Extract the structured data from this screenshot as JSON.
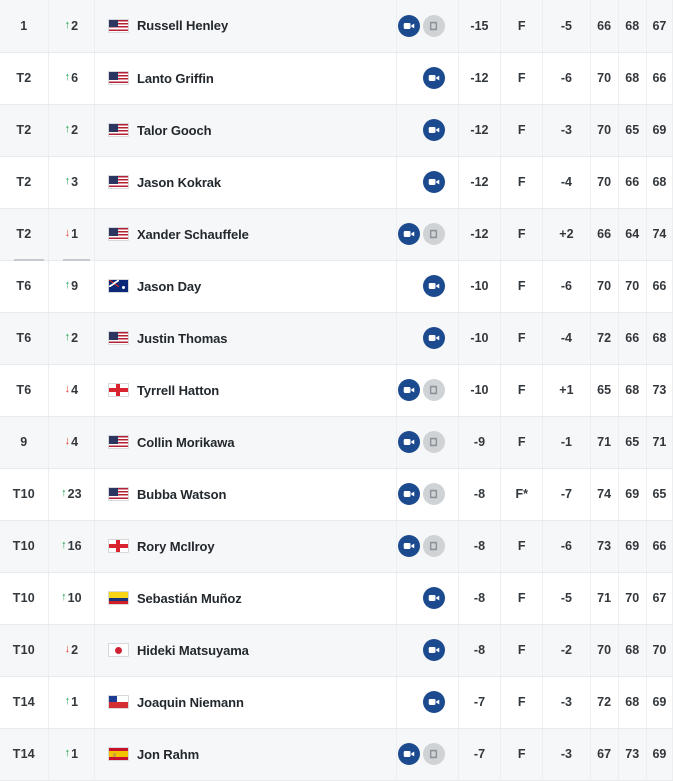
{
  "colors": {
    "accent_blue": "#1c4a8f",
    "doc_gray": "#cfd3d6",
    "up_green": "#19a04b",
    "down_red": "#e03127",
    "row_shade": "#f6f7f8",
    "row_plain": "#ffffff",
    "border": "#e8eaec",
    "text": "#2b2f33"
  },
  "icons": {
    "video": "video-camera-icon",
    "doc": "scorecard-icon",
    "arrow_up": "arrow-up-icon",
    "arrow_down": "arrow-down-icon"
  },
  "leaderboard": {
    "rows": [
      {
        "position": "1",
        "move_dir": "up",
        "move_value": "2",
        "country": "us",
        "country_name": "United States",
        "player": "Russell Henley",
        "has_video": true,
        "has_doc": true,
        "total": "-15",
        "thru": "F",
        "round": "-5",
        "r1": "66",
        "r2": "68",
        "r3": "67",
        "cut_after": false
      },
      {
        "position": "T2",
        "move_dir": "up",
        "move_value": "6",
        "country": "us",
        "country_name": "United States",
        "player": "Lanto Griffin",
        "has_video": true,
        "has_doc": false,
        "total": "-12",
        "thru": "F",
        "round": "-6",
        "r1": "70",
        "r2": "68",
        "r3": "66",
        "cut_after": false
      },
      {
        "position": "T2",
        "move_dir": "up",
        "move_value": "2",
        "country": "us",
        "country_name": "United States",
        "player": "Talor Gooch",
        "has_video": true,
        "has_doc": false,
        "total": "-12",
        "thru": "F",
        "round": "-3",
        "r1": "70",
        "r2": "65",
        "r3": "69",
        "cut_after": false
      },
      {
        "position": "T2",
        "move_dir": "up",
        "move_value": "3",
        "country": "us",
        "country_name": "United States",
        "player": "Jason Kokrak",
        "has_video": true,
        "has_doc": false,
        "total": "-12",
        "thru": "F",
        "round": "-4",
        "r1": "70",
        "r2": "66",
        "r3": "68",
        "cut_after": false
      },
      {
        "position": "T2",
        "move_dir": "down",
        "move_value": "1",
        "country": "us",
        "country_name": "United States",
        "player": "Xander Schauffele",
        "has_video": true,
        "has_doc": true,
        "total": "-12",
        "thru": "F",
        "round": "+2",
        "r1": "66",
        "r2": "64",
        "r3": "74",
        "cut_after": true
      },
      {
        "position": "T6",
        "move_dir": "up",
        "move_value": "9",
        "country": "au",
        "country_name": "Australia",
        "player": "Jason Day",
        "has_video": true,
        "has_doc": false,
        "total": "-10",
        "thru": "F",
        "round": "-6",
        "r1": "70",
        "r2": "70",
        "r3": "66",
        "cut_after": false
      },
      {
        "position": "T6",
        "move_dir": "up",
        "move_value": "2",
        "country": "us",
        "country_name": "United States",
        "player": "Justin Thomas",
        "has_video": true,
        "has_doc": false,
        "total": "-10",
        "thru": "F",
        "round": "-4",
        "r1": "72",
        "r2": "66",
        "r3": "68",
        "cut_after": false
      },
      {
        "position": "T6",
        "move_dir": "down",
        "move_value": "4",
        "country": "en",
        "country_name": "England",
        "player": "Tyrrell Hatton",
        "has_video": true,
        "has_doc": true,
        "total": "-10",
        "thru": "F",
        "round": "+1",
        "r1": "65",
        "r2": "68",
        "r3": "73",
        "cut_after": false
      },
      {
        "position": "9",
        "move_dir": "down",
        "move_value": "4",
        "country": "us",
        "country_name": "United States",
        "player": "Collin Morikawa",
        "has_video": true,
        "has_doc": true,
        "total": "-9",
        "thru": "F",
        "round": "-1",
        "r1": "71",
        "r2": "65",
        "r3": "71",
        "cut_after": false
      },
      {
        "position": "T10",
        "move_dir": "up",
        "move_value": "23",
        "country": "us",
        "country_name": "United States",
        "player": "Bubba Watson",
        "has_video": true,
        "has_doc": true,
        "total": "-8",
        "thru": "F*",
        "round": "-7",
        "r1": "74",
        "r2": "69",
        "r3": "65",
        "cut_after": false
      },
      {
        "position": "T10",
        "move_dir": "up",
        "move_value": "16",
        "country": "en",
        "country_name": "Northern Ireland",
        "player": "Rory McIlroy",
        "has_video": true,
        "has_doc": true,
        "total": "-8",
        "thru": "F",
        "round": "-6",
        "r1": "73",
        "r2": "69",
        "r3": "66",
        "cut_after": false
      },
      {
        "position": "T10",
        "move_dir": "up",
        "move_value": "10",
        "country": "co",
        "country_name": "Colombia",
        "player": "Sebastián Muñoz",
        "has_video": true,
        "has_doc": false,
        "total": "-8",
        "thru": "F",
        "round": "-5",
        "r1": "71",
        "r2": "70",
        "r3": "67",
        "cut_after": false
      },
      {
        "position": "T10",
        "move_dir": "down",
        "move_value": "2",
        "country": "jp",
        "country_name": "Japan",
        "player": "Hideki Matsuyama",
        "has_video": true,
        "has_doc": false,
        "total": "-8",
        "thru": "F",
        "round": "-2",
        "r1": "70",
        "r2": "68",
        "r3": "70",
        "cut_after": false
      },
      {
        "position": "T14",
        "move_dir": "up",
        "move_value": "1",
        "country": "cl",
        "country_name": "Chile",
        "player": "Joaquin Niemann",
        "has_video": true,
        "has_doc": false,
        "total": "-7",
        "thru": "F",
        "round": "-3",
        "r1": "72",
        "r2": "68",
        "r3": "69",
        "cut_after": false
      },
      {
        "position": "T14",
        "move_dir": "up",
        "move_value": "1",
        "country": "es",
        "country_name": "Spain",
        "player": "Jon Rahm",
        "has_video": true,
        "has_doc": true,
        "total": "-7",
        "thru": "F",
        "round": "-3",
        "r1": "67",
        "r2": "73",
        "r3": "69",
        "cut_after": false
      }
    ]
  }
}
